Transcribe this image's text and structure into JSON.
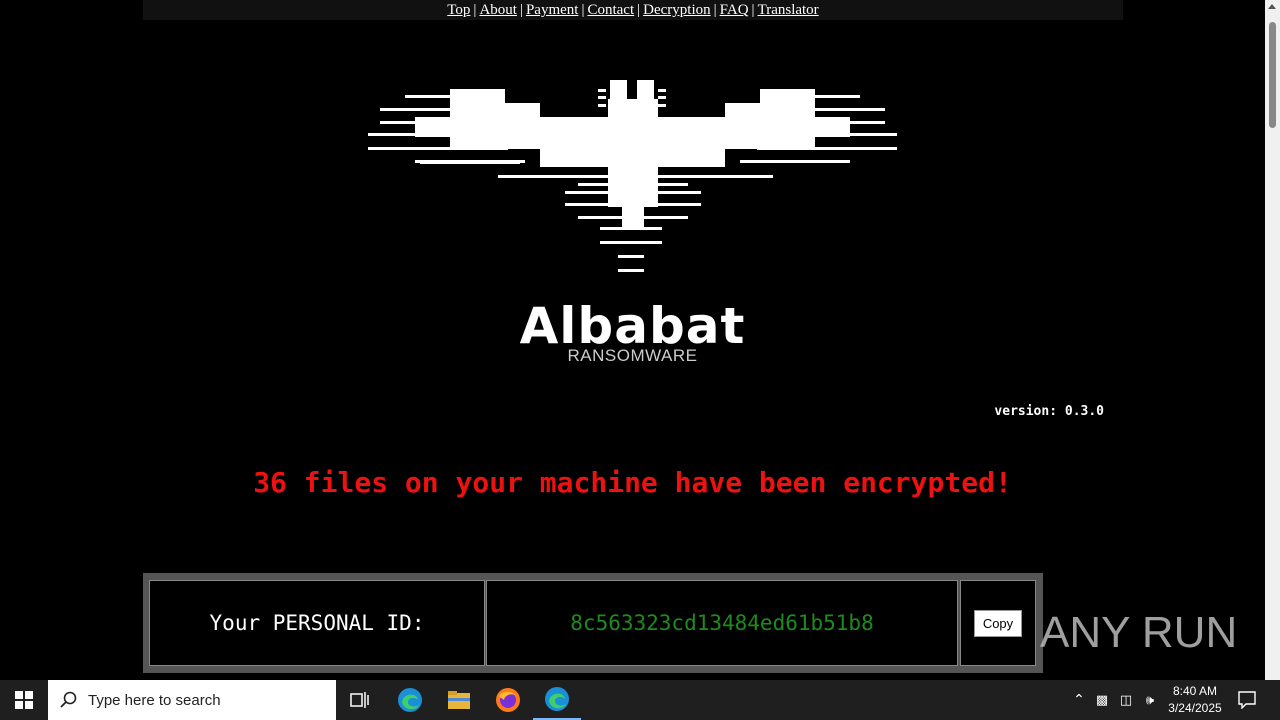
{
  "nav": {
    "links": [
      "Top",
      "About",
      "Payment",
      "Contact",
      "Decryption",
      "FAQ",
      "Translator"
    ],
    "separator": "|"
  },
  "brand": {
    "name": "Albabat",
    "subtitle": "RANSOMWARE"
  },
  "version": "version: 0.3.0",
  "headline": "36 files on your machine have been encrypted!",
  "personal_id": {
    "label": "Your PERSONAL ID:",
    "value": "8c563323cd13484ed61b51b8",
    "copy_label": "Copy"
  },
  "watermark": "ANY RUN",
  "taskbar": {
    "search_placeholder": "Type here to search",
    "time": "8:40 AM",
    "date": "3/24/2025"
  },
  "colors": {
    "headline": "#ee1111",
    "id_value": "#1f8a1f",
    "background": "#000000"
  },
  "icons": [
    "windows-start-icon",
    "search-icon",
    "task-view-icon",
    "edge-icon",
    "file-explorer-icon",
    "firefox-icon",
    "edge-active-icon",
    "tray-chevron-icon",
    "meet-icon",
    "network-icon",
    "volume-icon",
    "notifications-icon"
  ]
}
